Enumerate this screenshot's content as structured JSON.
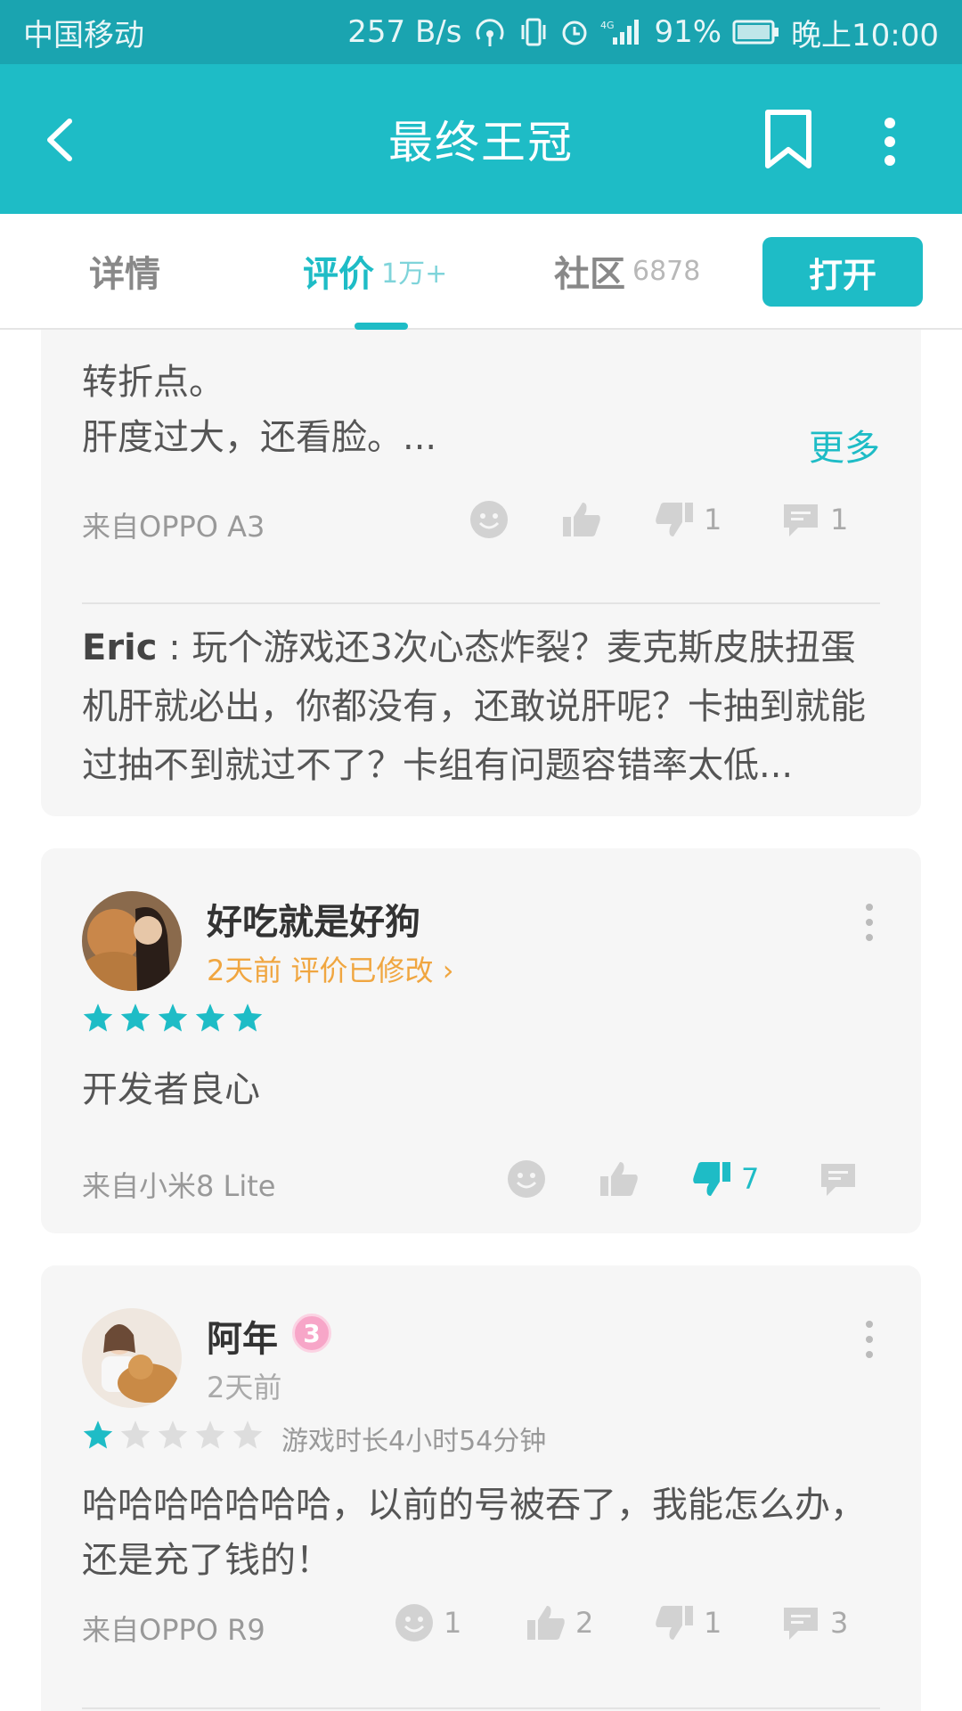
{
  "status_bar": {
    "carrier": "中国移动",
    "net_speed": "257 B/s",
    "battery": "91%",
    "time": "晚上10:00"
  },
  "app_bar": {
    "title": "最终王冠"
  },
  "tabs": [
    {
      "label": "详情",
      "count": ""
    },
    {
      "label": "评价",
      "count": "1万+"
    },
    {
      "label": "社区",
      "count": "6878"
    }
  ],
  "open_button": "打开",
  "reviews": [
    {
      "text_line1": "转折点。",
      "text_line2": "肝度过大，还看脸。...",
      "more": "更多",
      "device": "来自OPPO A3",
      "dislikes": "1",
      "comments": "1",
      "reply_author": "Eric",
      "reply_text": " : 玩个游戏还3次心态炸裂？麦克斯皮肤扭蛋机肝就必出，你都没有，还敢说肝呢？卡抽到就能过抽不到就过不了？卡组有问题容错率太低..."
    },
    {
      "username": "好吃就是好狗",
      "meta": "2天前  评价已修改 ›",
      "rating": 5,
      "text": "开发者良心",
      "device": "来自小米8 Lite",
      "dislikes": "7"
    },
    {
      "username": "阿年",
      "badge": "3",
      "meta": "2天前",
      "rating": 1,
      "playtime": "游戏时长4小时54分钟",
      "text": "哈哈哈哈哈哈哈，以前的号被吞了，我能怎么办，还是充了钱的！",
      "device": "来自OPPO R9",
      "emoji": "1",
      "likes": "2",
      "dislikes": "1",
      "comments": "3"
    }
  ],
  "colors": {
    "accent": "#1ebcc6",
    "status_bar": "#1aa4b0",
    "star_empty": "#dddddd",
    "orange": "#f0a640"
  }
}
